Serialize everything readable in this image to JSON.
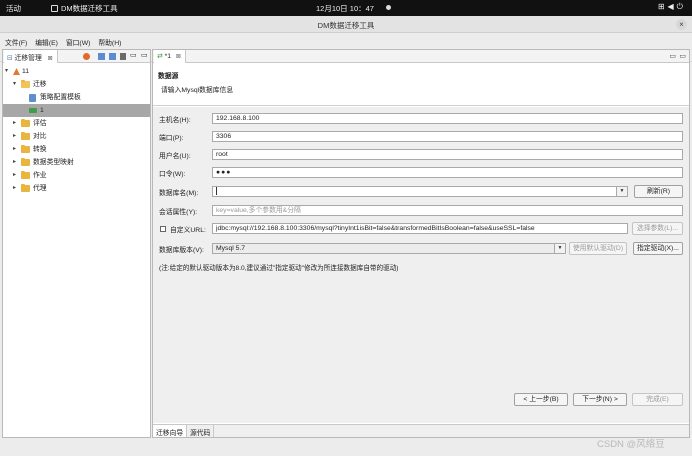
{
  "topbar": {
    "activities": "活动",
    "app_name": "DM数据迁移工具",
    "clock": "12月10日 10：47",
    "system_icons": "network-icon volume-icon power-icon"
  },
  "window": {
    "title": "DM数据迁移工具",
    "close": "×"
  },
  "menu": {
    "items": [
      "文件(F)",
      "编辑(E)",
      "窗口(W)",
      "帮助(H)"
    ]
  },
  "left_view": {
    "tab_label": "迁移管理",
    "tree": [
      {
        "label": "11",
        "level": 0,
        "expanded": true,
        "icon": "project-icon"
      },
      {
        "label": "迁移",
        "level": 1,
        "expanded": true,
        "icon": "folder-open-icon"
      },
      {
        "label": "策略配置模板",
        "level": 2,
        "icon": "template-icon"
      },
      {
        "label": "1",
        "level": 2,
        "icon": "migration-item-icon",
        "selected": true
      },
      {
        "label": "评估",
        "level": 1,
        "icon": "folder-icon"
      },
      {
        "label": "对比",
        "level": 1,
        "icon": "folder-icon"
      },
      {
        "label": "转换",
        "level": 1,
        "icon": "folder-icon"
      },
      {
        "label": "数据类型映射",
        "level": 1,
        "icon": "folder-icon"
      },
      {
        "label": "作业",
        "level": 1,
        "icon": "folder-icon"
      },
      {
        "label": "代理",
        "level": 1,
        "icon": "folder-icon"
      }
    ]
  },
  "editor": {
    "tab_label": "*1",
    "header_title": "数据源",
    "header_desc": "请输入Mysql数据库信息",
    "form": {
      "host_label": "主机名(H):",
      "host_value": "192.168.8.100",
      "port_label": "端口(P):",
      "port_value": "3306",
      "user_label": "用户名(U):",
      "user_value": "root",
      "password_label": "口令(W):",
      "password_value": "●●●",
      "db_label": "数据库名(M):",
      "db_value": "",
      "refresh_button": "刷新(R)",
      "session_label": "会话属性(Y):",
      "session_placeholder": "key=value,多个参数用&分隔",
      "custom_url_label": "自定义URL:",
      "custom_url_value": "jdbc:mysql://192.168.8.100:3306/mysql?tinyInt1isBit=false&transformedBitIsBoolean=false&useSSL=false",
      "select_params_button": "选择参数(L)...",
      "driver_version_label": "数据库版本(V):",
      "driver_version_value": "Mysql 5.7",
      "default_driver_button": "使用默认驱动(D)",
      "specify_driver_button": "指定驱动(X)...",
      "note": "(注:给定的默认驱动版本为8.0,建议通过\"指定驱动\"修改为所连接数据库自带的驱动)"
    },
    "nav": {
      "back": "< 上一步(B)",
      "next": "下一步(N) >",
      "finish": "完成(E)"
    },
    "bottom_tabs": [
      "迁移向导",
      "源代码"
    ]
  },
  "watermark": "CSDN @风络豆"
}
